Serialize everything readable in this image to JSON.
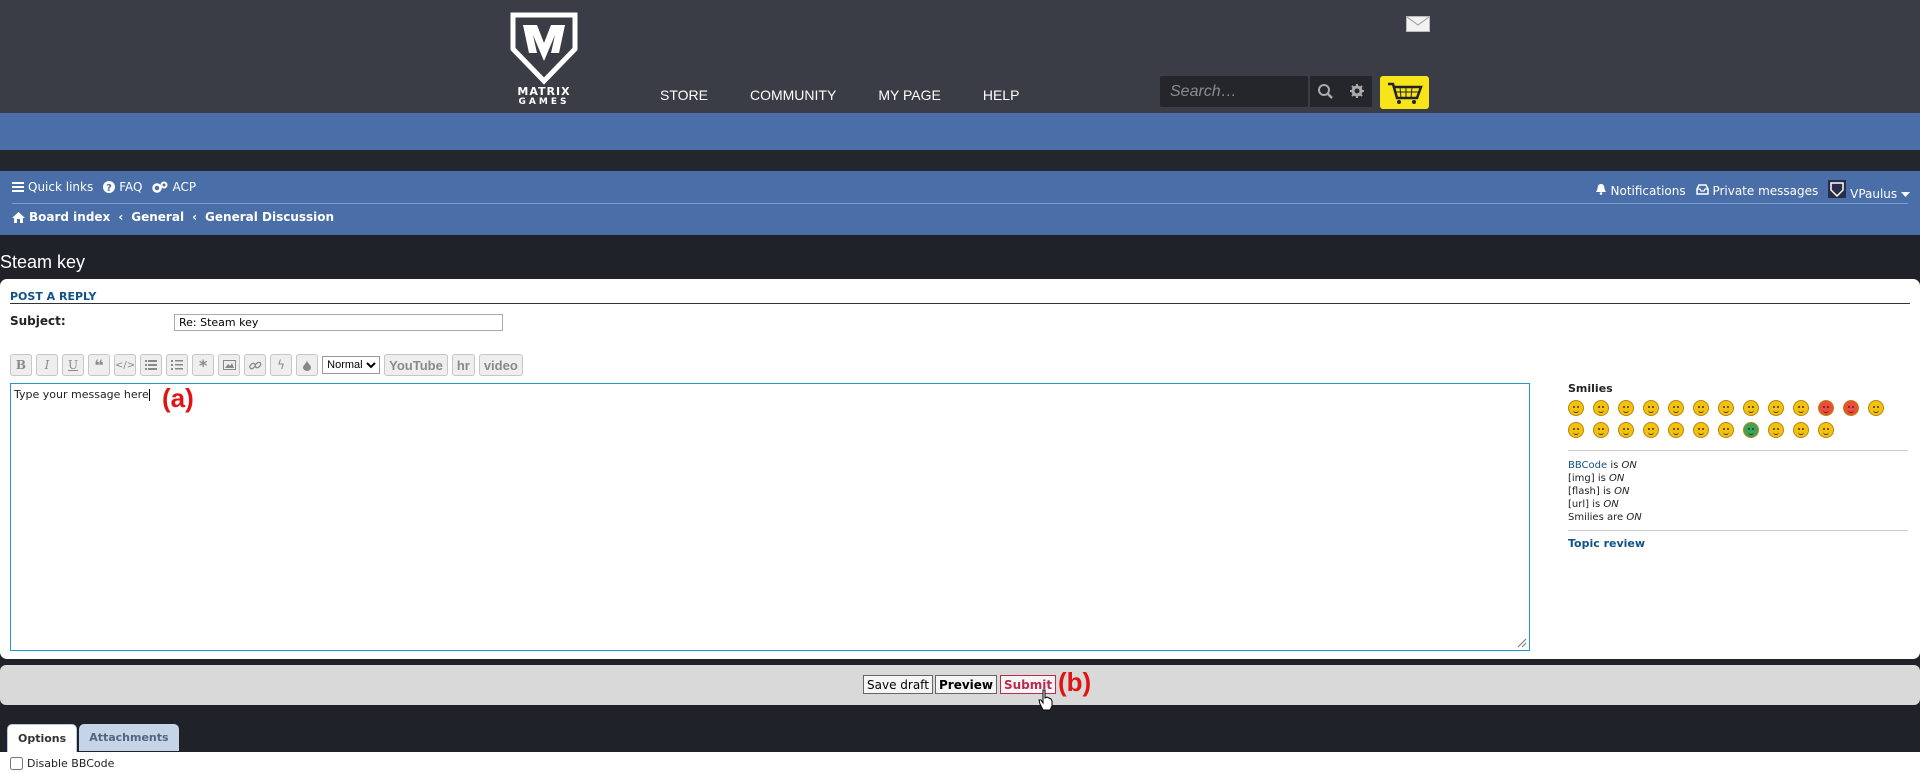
{
  "header": {
    "logo_text_line1": "MATRIX",
    "logo_text_line2": "GAMES",
    "nav": [
      "STORE",
      "COMMUNITY",
      "MY PAGE",
      "HELP"
    ],
    "search_placeholder": "Search…"
  },
  "forum_nav": {
    "quick_links": "Quick links",
    "faq": "FAQ",
    "acp": "ACP",
    "notifications": "Notifications",
    "private_messages": "Private messages",
    "username": "VPaulus",
    "breadcrumb": [
      "Board index",
      "General",
      "General Discussion"
    ]
  },
  "page_title": "Steam key",
  "form": {
    "heading": "POST A REPLY",
    "subject_label": "Subject:",
    "subject_value": "Re: Steam key",
    "toolbar": {
      "bold": "B",
      "italic": "I",
      "underline": "U",
      "font_size_selected": "Normal",
      "youtube": "YouTube",
      "hr": "hr",
      "video": "video"
    },
    "message_placeholder": "Type your message here"
  },
  "annotations": {
    "a": "(a)",
    "b": "(b)"
  },
  "sidebar": {
    "smilies_title": "Smilies",
    "smilies_count": 24,
    "bbcode_link": "BBCode",
    "bbcode_status": "ON",
    "img_label": "[img]",
    "img_status": "ON",
    "flash_label": "[flash]",
    "flash_status": "ON",
    "url_label": "[url]",
    "url_status": "ON",
    "smilies_label": "Smilies are",
    "smilies_status": "ON",
    "is_word": "is",
    "topic_review": "Topic review"
  },
  "buttons": {
    "save_draft": "Save draft",
    "preview": "Preview",
    "submit": "Submit"
  },
  "tabs": [
    "Options",
    "Attachments"
  ],
  "options": {
    "disable_bbcode": "Disable BBCode"
  },
  "colors": {
    "header_bg": "#3a3d45",
    "forum_blue": "#4a6ea8",
    "cart_yellow": "#f7e51a",
    "annotation_red": "#e01414",
    "submit_red": "#bc2a4d"
  }
}
